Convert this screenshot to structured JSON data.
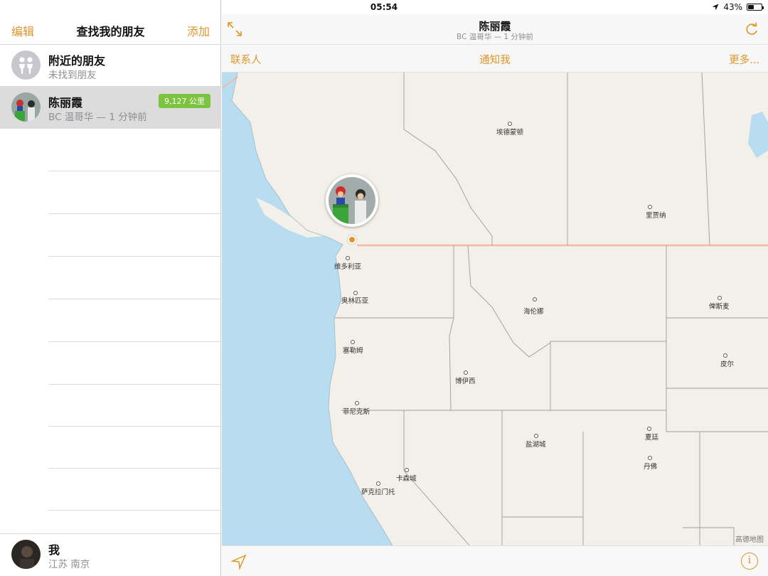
{
  "status_bar": {
    "device": "iPad",
    "time": "05:54",
    "battery": "43%",
    "battery_level": 0.43
  },
  "left": {
    "nav": {
      "edit": "编辑",
      "title": "查找我的朋友",
      "add": "添加"
    },
    "nearby": {
      "title": "附近的朋友",
      "subtitle": "未找到朋友"
    },
    "friend": {
      "name": "陈丽霞",
      "location": "BC 温哥华 — 1 分钟前",
      "distance": "9,127 公里"
    },
    "me": {
      "name": "我",
      "location": "江苏 南京"
    }
  },
  "right": {
    "title": "陈丽霞",
    "subtitle": "BC 温哥华 — 1 分钟前",
    "toolbar": {
      "contacts": "联系人",
      "notify": "通知我",
      "more": "更多..."
    },
    "info_glyph": "i",
    "map_legal": "高德地图",
    "cities": [
      {
        "name": "埃德蒙顿"
      },
      {
        "name": "里贾纳"
      },
      {
        "name": "维多利亚"
      },
      {
        "name": "奥林匹亚"
      },
      {
        "name": "海伦娜"
      },
      {
        "name": "俾斯麦"
      },
      {
        "name": "塞勒姆"
      },
      {
        "name": "博伊西"
      },
      {
        "name": "皮尔"
      },
      {
        "name": "菲尼克斯"
      },
      {
        "name": "夏廷"
      },
      {
        "name": "盐湖城"
      },
      {
        "name": "丹佛"
      },
      {
        "name": "卡森城"
      },
      {
        "name": "萨克拉门托"
      }
    ]
  },
  "colors": {
    "accent": "#e0952a",
    "badge": "#7cc341",
    "water": "#b8dcf0",
    "land": "#f3f0ea",
    "border": "#f2b9a8"
  }
}
